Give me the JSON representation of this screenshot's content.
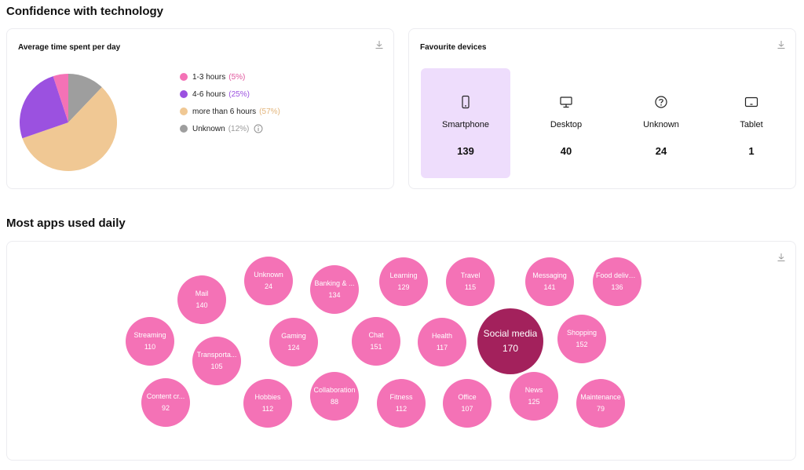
{
  "page": {
    "title": "Confidence with technology",
    "apps_title": "Most apps used daily"
  },
  "time_card": {
    "title": "Average time spent per day",
    "legend": [
      {
        "label": "1-3 hours",
        "pct": "(5%)",
        "color": "#f472b6"
      },
      {
        "label": "4-6 hours",
        "pct": "(25%)",
        "color": "#9b51e0"
      },
      {
        "label": "more than 6 hours",
        "pct": "(57%)",
        "color": "#f0c894"
      },
      {
        "label": "Unknown",
        "pct": "(12%)",
        "color": "#9e9e9e"
      }
    ]
  },
  "devices_card": {
    "title": "Favourite devices",
    "devices": [
      {
        "label": "Smartphone",
        "count": "139",
        "icon": "smartphone-icon"
      },
      {
        "label": "Desktop",
        "count": "40",
        "icon": "desktop-icon"
      },
      {
        "label": "Unknown",
        "count": "24",
        "icon": "question-icon"
      },
      {
        "label": "Tablet",
        "count": "1",
        "icon": "tablet-icon"
      }
    ]
  },
  "apps": [
    {
      "name": "Mail",
      "value": "140"
    },
    {
      "name": "Unknown",
      "value": "24"
    },
    {
      "name": "Banking & ...",
      "value": "134"
    },
    {
      "name": "Learning",
      "value": "129"
    },
    {
      "name": "Travel",
      "value": "115"
    },
    {
      "name": "Messaging",
      "value": "141"
    },
    {
      "name": "Food delivery",
      "value": "136"
    },
    {
      "name": "Streaming",
      "value": "110"
    },
    {
      "name": "Transporta...",
      "value": "105"
    },
    {
      "name": "Gaming",
      "value": "124"
    },
    {
      "name": "Chat",
      "value": "151"
    },
    {
      "name": "Health",
      "value": "117"
    },
    {
      "name": "Social media",
      "value": "170"
    },
    {
      "name": "Shopping",
      "value": "152"
    },
    {
      "name": "Content cr...",
      "value": "92"
    },
    {
      "name": "Hobbies",
      "value": "112"
    },
    {
      "name": "Collaboration",
      "value": "88"
    },
    {
      "name": "Fitness",
      "value": "112"
    },
    {
      "name": "Office",
      "value": "107"
    },
    {
      "name": "News",
      "value": "125"
    },
    {
      "name": "Maintenance",
      "value": "79"
    }
  ],
  "chart_data": {
    "type": "pie",
    "categories": [
      "1-3 hours",
      "4-6 hours",
      "more than 6 hours",
      "Unknown"
    ],
    "values": [
      5,
      25,
      57,
      12
    ]
  }
}
